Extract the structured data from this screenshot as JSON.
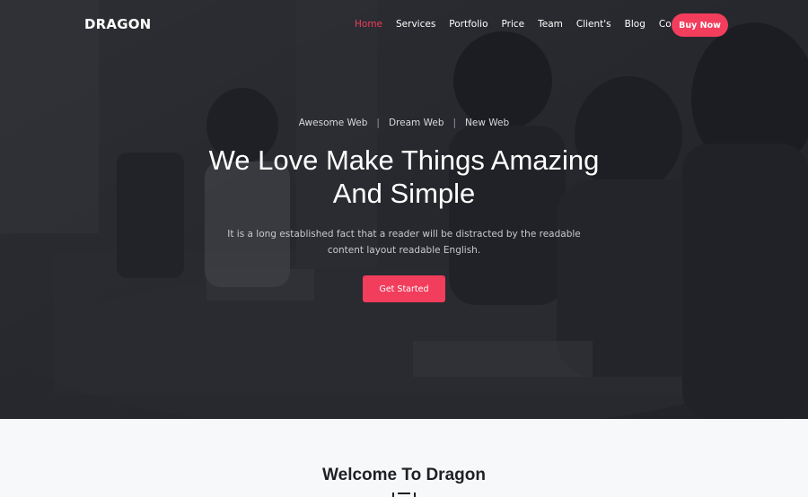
{
  "brand": "DRAGON",
  "nav": {
    "items": [
      "Home",
      "Services",
      "Portfolio",
      "Price",
      "Team",
      "Client's",
      "Blog",
      "Contact"
    ],
    "active": "Home",
    "buy_label": "Buy Now"
  },
  "hero": {
    "taglines": [
      "Awesome Web",
      "Dream Web",
      "New Web"
    ],
    "separator": "|",
    "title_line1": "We Love Make Things Amazing",
    "title_line2": "And Simple",
    "desc_line1": "It is a long established fact that a reader will be distracted by the readable",
    "desc_line2": "content layout readable English.",
    "cta_label": "Get Started"
  },
  "welcome": {
    "title": "Welcome To Dragon"
  },
  "colors": {
    "accent": "#f23d5c",
    "overlay": "#1c1d22",
    "section_bg": "#f7f8fa"
  }
}
